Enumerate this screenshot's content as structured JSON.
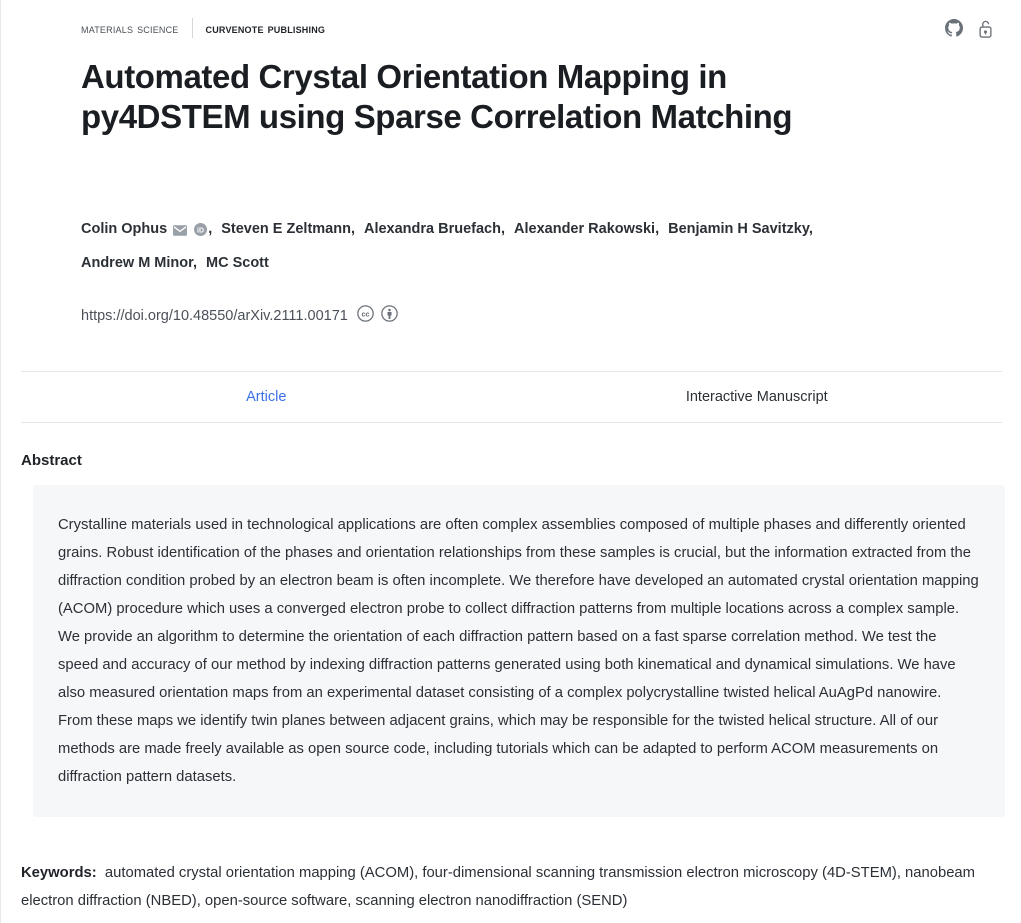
{
  "header": {
    "journal": "Materials Science",
    "publisher": "Curvenote Publishing",
    "actions": [
      {
        "name": "github-icon",
        "label": "GitHub"
      },
      {
        "name": "open-access-icon",
        "label": "Open Access"
      }
    ]
  },
  "article": {
    "title": "Automated Crystal Orientation Mapping in py4DSTEM using Sparse Correlation Matching",
    "authors": [
      {
        "name": "Colin Ophus",
        "icons": [
          "email-icon",
          "orcid-icon"
        ]
      },
      {
        "name": "Steven E Zeltmann",
        "icons": []
      },
      {
        "name": "Alexandra Bruefach",
        "icons": []
      },
      {
        "name": "Alexander Rakowski",
        "icons": []
      },
      {
        "name": "Benjamin H Savitzky",
        "icons": []
      },
      {
        "name": "Andrew M Minor",
        "icons": []
      },
      {
        "name": "MC Scott",
        "icons": []
      }
    ],
    "doi": "https://doi.org/10.48550/arXiv.2111.00171",
    "license_icons": [
      "creative-commons-icon",
      "cc-by-icon"
    ]
  },
  "tabs": [
    {
      "label": "Article",
      "active": true
    },
    {
      "label": "Interactive Manuscript",
      "active": false
    }
  ],
  "abstract": {
    "heading": "Abstract",
    "body": "Crystalline materials used in technological applications are often complex assemblies composed of multiple phases and differently oriented grains. Robust identification of the phases and orientation relationships from these samples is crucial, but the information extracted from the diffraction condition probed by an electron beam is often incomplete. We therefore have developed an automated crystal orientation mapping (ACOM) procedure which uses a converged electron probe to collect diffraction patterns from multiple locations across a complex sample. We provide an algorithm to determine the orientation of each diffraction pattern based on a fast sparse correlation method. We test the speed and accuracy of our method by indexing diffraction patterns generated using both kinematical and dynamical simulations. We have also measured orientation maps from an experimental dataset consisting of a complex polycrystalline twisted helical AuAgPd nanowire. From these maps we identify twin planes between adjacent grains, which may be responsible for the twisted helical structure. All of our methods are made freely available as open source code, including tutorials which can be adapted to perform ACOM measurements on diffraction pattern datasets."
  },
  "keywords": {
    "label": "Keywords:",
    "values": "automated crystal orientation mapping (ACOM), four-dimensional scanning transmission electron microscopy (4D-STEM), nanobeam electron diffraction (NBED), open-source software, scanning electron nanodiffraction (SEND)"
  },
  "colors": {
    "accent": "#3b6fe8",
    "text": "#1f2328",
    "muted": "#4b5159",
    "abstract_bg": "#f6f7f9",
    "rule": "#e6e7ea"
  }
}
